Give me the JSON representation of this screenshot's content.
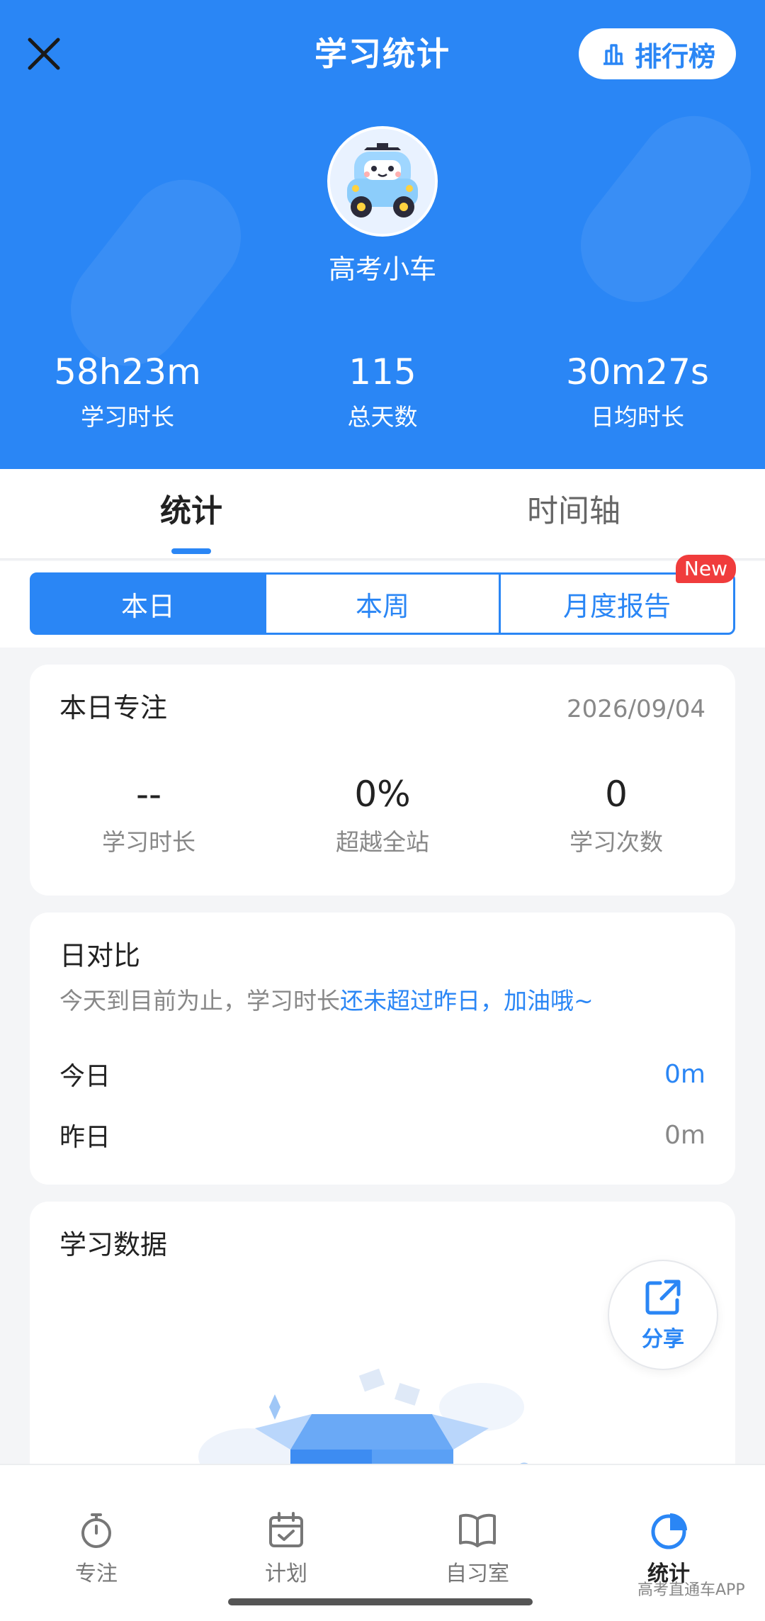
{
  "header": {
    "title": "学习统计",
    "rank_label": "排行榜",
    "username": "高考小车",
    "stats": [
      {
        "value": "58h23m",
        "label": "学习时长"
      },
      {
        "value": "115",
        "label": "总天数"
      },
      {
        "value": "30m27s",
        "label": "日均时长"
      }
    ]
  },
  "tabs": [
    {
      "label": "统计",
      "active": true
    },
    {
      "label": "时间轴",
      "active": false
    }
  ],
  "segments": [
    {
      "label": "本日",
      "active": true
    },
    {
      "label": "本周",
      "active": false
    },
    {
      "label": "月度报告",
      "active": false,
      "badge": "New"
    }
  ],
  "focus_card": {
    "title": "本日专注",
    "date": "2026/09/04",
    "metrics": [
      {
        "value": "--",
        "label": "学习时长"
      },
      {
        "value": "0%",
        "label": "超越全站"
      },
      {
        "value": "0",
        "label": "学习次数"
      }
    ]
  },
  "compare_card": {
    "title": "日对比",
    "subtitle_prefix": "今天到目前为止，学习时长",
    "subtitle_highlight": "还未超过昨日，加油哦~",
    "rows": [
      {
        "key": "今日",
        "value": "0m"
      },
      {
        "key": "昨日",
        "value": "0m"
      }
    ]
  },
  "data_card": {
    "title": "学习数据",
    "share_label": "分享"
  },
  "bottom_nav": [
    {
      "label": "专注",
      "icon": "stopwatch-icon",
      "active": false
    },
    {
      "label": "计划",
      "icon": "calendar-check-icon",
      "active": false
    },
    {
      "label": "自习室",
      "icon": "open-book-icon",
      "active": false
    },
    {
      "label": "统计",
      "icon": "pie-chart-icon",
      "active": true
    }
  ],
  "watermark": "高考直通车APP",
  "colors": {
    "primary": "#2a86f5",
    "badge": "#f03c3c"
  }
}
